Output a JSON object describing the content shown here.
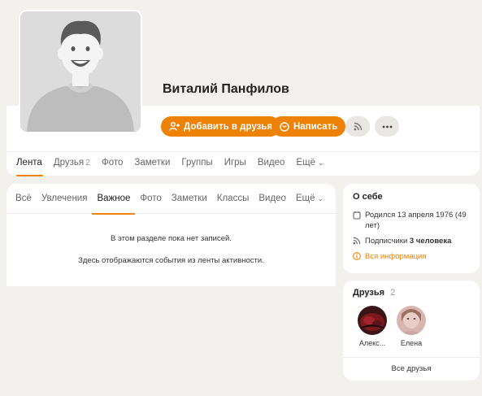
{
  "profile": {
    "name": "Виталий Панфилов",
    "add_friend_label": "Добавить в друзья",
    "message_label": "Написать",
    "subscribe_icon": "rss-icon",
    "more_icon": "more-dots-icon"
  },
  "main_tabs": [
    {
      "label": "Лента",
      "count": "",
      "active": true
    },
    {
      "label": "Друзья",
      "count": "2",
      "active": false
    },
    {
      "label": "Фото",
      "count": "",
      "active": false
    },
    {
      "label": "Заметки",
      "count": "",
      "active": false
    },
    {
      "label": "Группы",
      "count": "",
      "active": false
    },
    {
      "label": "Игры",
      "count": "",
      "active": false
    },
    {
      "label": "Видео",
      "count": "",
      "active": false
    },
    {
      "label": "Ещё",
      "count": "",
      "active": false
    }
  ],
  "feed": {
    "tabs": [
      {
        "label": "Всё",
        "active": false
      },
      {
        "label": "Увлечения",
        "active": false
      },
      {
        "label": "Важное",
        "active": true
      },
      {
        "label": "Фото",
        "active": false
      },
      {
        "label": "Заметки",
        "active": false
      },
      {
        "label": "Классы",
        "active": false
      },
      {
        "label": "Видео",
        "active": false
      },
      {
        "label": "Ещё",
        "active": false
      }
    ],
    "empty_line1": "В этом разделе пока нет записей.",
    "empty_line2": "Здесь отображаются события из ленты активности."
  },
  "about": {
    "title": "О себе",
    "birth": "Родился 13 апреля 1976 (49 лет)",
    "subscribers_prefix": "Подписчики",
    "subscribers_value": "3 человека",
    "all_info": "Вся информация"
  },
  "friends": {
    "title": "Друзья",
    "count": "2",
    "items": [
      {
        "name": "Алекс..."
      },
      {
        "name": "Елена"
      }
    ],
    "all_label": "Все друзья"
  },
  "colors": {
    "accent": "#ee8208",
    "background": "#f3f1ed",
    "card": "#ffffff"
  }
}
